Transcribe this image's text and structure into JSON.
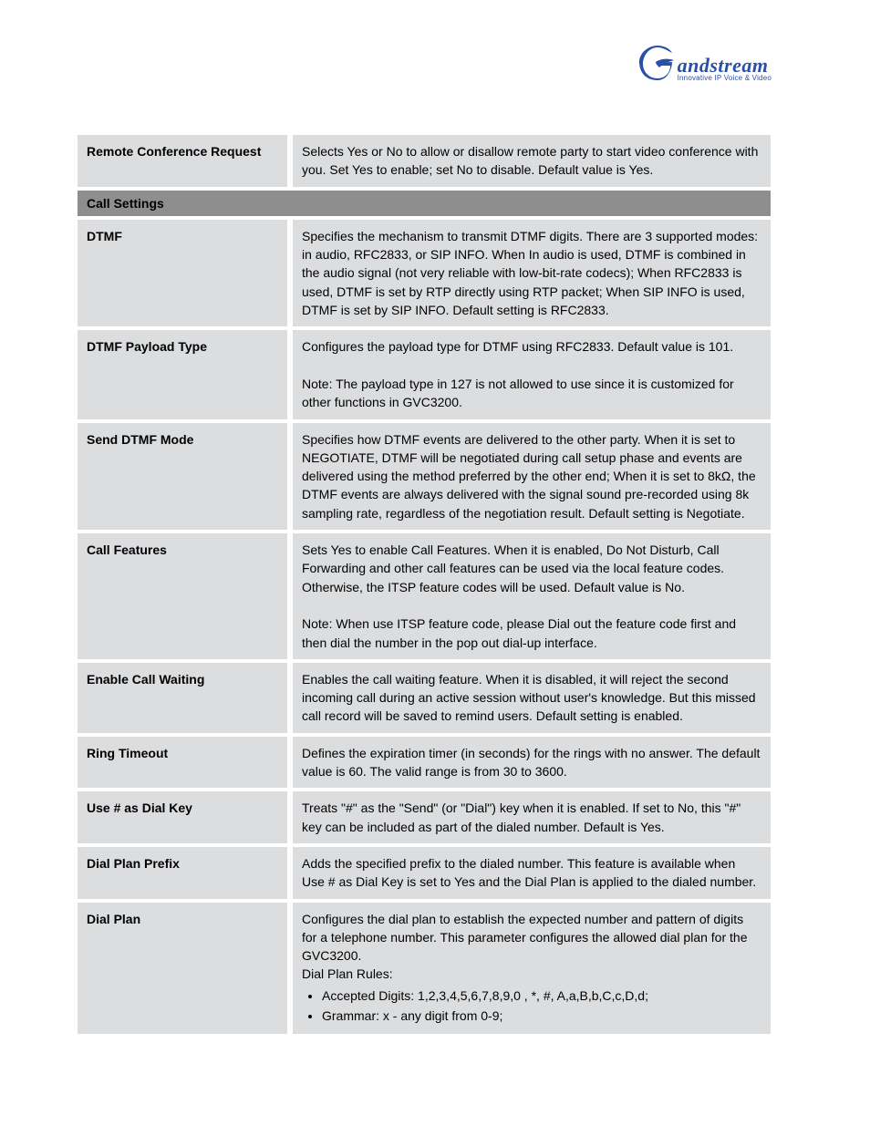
{
  "logo": {
    "brand_suffix": "andstream",
    "tagline": "Innovative IP Voice & Video"
  },
  "rows": [
    {
      "label": "Remote Conference Request",
      "value": "Selects Yes or No to allow or disallow remote party to start video conference with you. Set Yes to enable; set No to disable. Default value is Yes."
    },
    {
      "type": "section",
      "label": "Call Settings"
    },
    {
      "label": "DTMF",
      "value": "Specifies the mechanism to transmit DTMF digits. There are 3 supported modes: in audio, RFC2833, or SIP INFO. When In audio is used, DTMF is combined in the audio signal (not very reliable with low-bit-rate codecs); When RFC2833 is used, DTMF is set by RTP directly using RTP packet; When SIP INFO is used, DTMF is set by SIP INFO. Default setting is RFC2833."
    },
    {
      "label": "DTMF Payload Type",
      "value": "Configures the payload type for DTMF using RFC2833. Default value is 101.\n\nNote: The payload type in 127 is not allowed to use since it is customized for other functions in GVC3200."
    },
    {
      "label": "Send DTMF Mode",
      "value": "Specifies how DTMF events are delivered to the other party. When it is set to NEGOTIATE, DTMF will be negotiated during call setup phase and events are delivered using the method preferred by the other end; When it is set to 8kΩ, the DTMF events are always delivered with the signal sound pre-recorded using 8k sampling rate, regardless of the negotiation result. Default setting is Negotiate."
    },
    {
      "label": "Call Features",
      "value": "Sets Yes to enable Call Features. When it is enabled, Do Not Disturb, Call Forwarding and other call features can be used via the local feature codes. Otherwise, the ITSP feature codes will be used. Default value is No.\n\nNote: When use ITSP feature code, please Dial out the feature code first and then dial the number in the pop out dial-up interface."
    },
    {
      "label": "Enable Call Waiting",
      "value": "Enables the call waiting feature. When it is disabled, it will reject the second incoming call during an active session without user's knowledge. But this missed call record will be saved to remind users. Default setting is enabled."
    },
    {
      "label": "Ring Timeout",
      "value": "Defines the expiration timer (in seconds) for the rings with no answer. The default value is 60. The valid range is from 30 to 3600."
    },
    {
      "label": "Use # as Dial Key",
      "value": "Treats \"#\" as the \"Send\" (or \"Dial\") key when it is enabled. If set to No, this \"#\" key can be included as part of the dialed number. Default is Yes."
    },
    {
      "label": "Dial Plan Prefix",
      "value": "Adds the specified prefix to the dialed number. This feature is available when Use # as Dial Key is set to Yes and the Dial Plan is applied to the dialed number."
    },
    {
      "label": "Dial Plan",
      "value": "Configures the dial plan to establish the expected number and pattern of digits for a telephone number. This parameter configures the allowed dial plan for the GVC3200.\nDial Plan Rules:",
      "bullets": [
        "Accepted Digits: 1,2,3,4,5,6,7,8,9,0 , *, #, A,a,B,b,C,c,D,d;",
        "Grammar: x - any digit from 0-9;"
      ]
    }
  ]
}
